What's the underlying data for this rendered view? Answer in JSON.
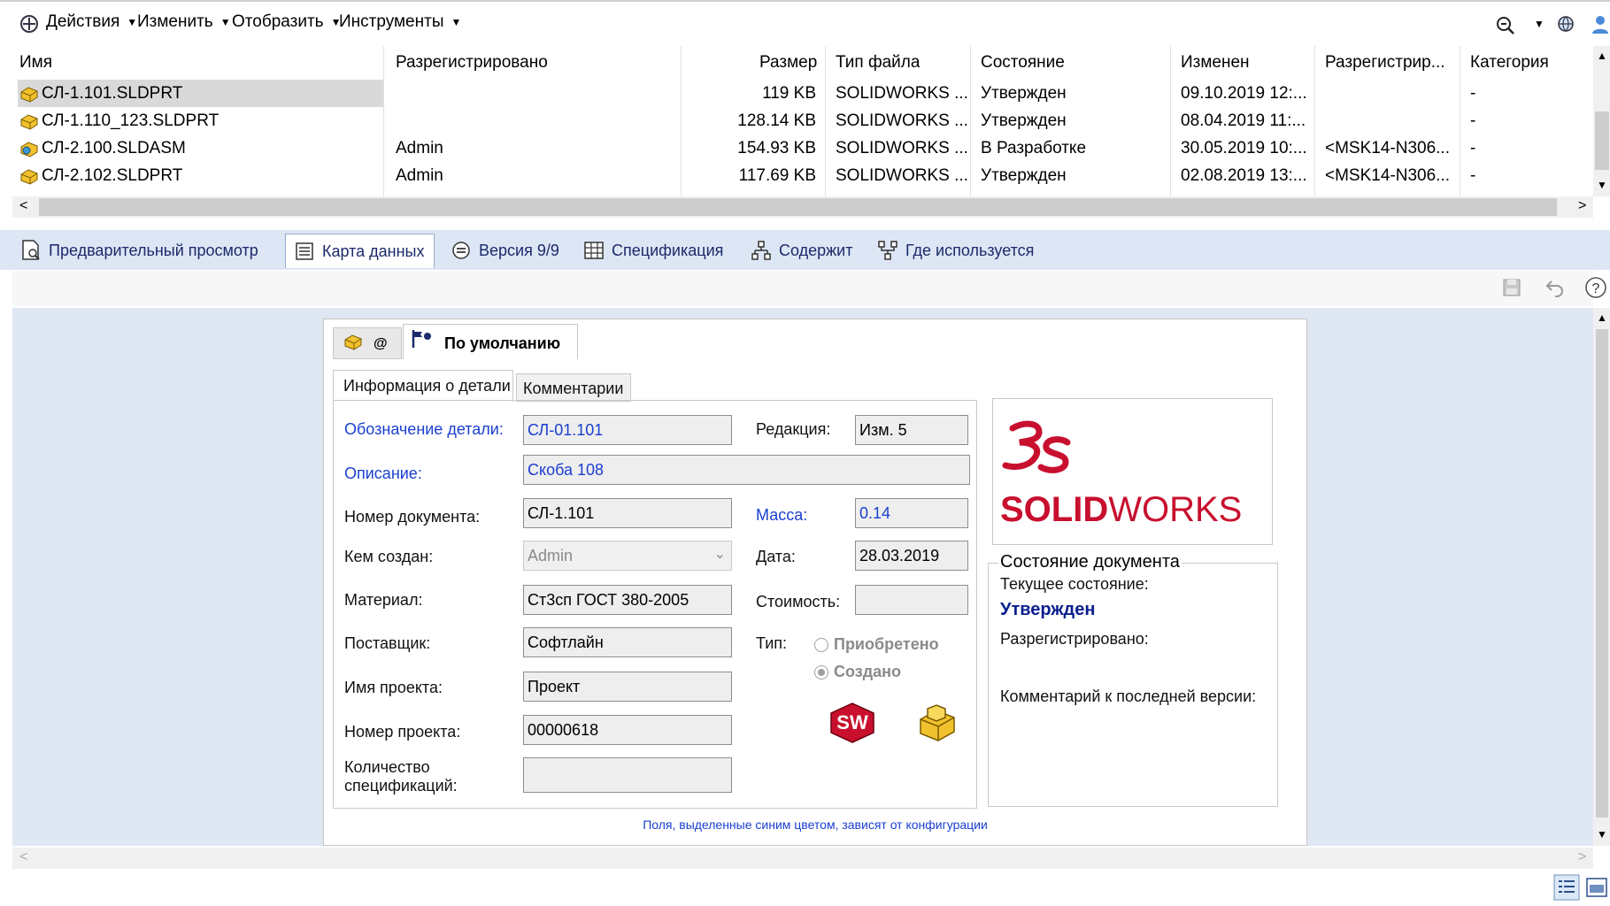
{
  "toolbar": {
    "menus": [
      "Действия",
      "Изменить",
      "Отобразить",
      "Инструменты"
    ]
  },
  "grid": {
    "columns": [
      "Имя",
      "Разрегистрировано",
      "Размер",
      "Тип файла",
      "Состояние",
      "Изменен",
      "Разрегистрир...",
      "Категория"
    ],
    "rows": [
      {
        "name": "СЛ-1.101.SLDPRT",
        "checked_out": "",
        "size": "119 KB",
        "type": "SOLIDWORKS ...",
        "state": "Утвержден",
        "modified": "09.10.2019 12:...",
        "checked_out_in": "",
        "category": "-"
      },
      {
        "name": "СЛ-1.110_123.SLDPRT",
        "checked_out": "",
        "size": "128.14 KB",
        "type": "SOLIDWORKS ...",
        "state": "Утвержден",
        "modified": "08.04.2019 11:...",
        "checked_out_in": "",
        "category": "-"
      },
      {
        "name": "СЛ-2.100.SLDASM",
        "checked_out": "Admin",
        "size": "154.93 KB",
        "type": "SOLIDWORKS ...",
        "state": "В Разработке",
        "modified": "30.05.2019 10:...",
        "checked_out_in": "<MSK14-N306...",
        "category": "-"
      },
      {
        "name": "СЛ-2.102.SLDPRT",
        "checked_out": "Admin",
        "size": "117.69 KB",
        "type": "SOLIDWORKS ...",
        "state": "Утвержден",
        "modified": "02.08.2019 13:...",
        "checked_out_in": "<MSK14-N306...",
        "category": "-"
      }
    ]
  },
  "tabs": [
    {
      "label": "Предварительный просмотр"
    },
    {
      "label": "Карта данных"
    },
    {
      "label": "Версия 9/9"
    },
    {
      "label": "Спецификация"
    },
    {
      "label": "Содержит"
    },
    {
      "label": "Где используется"
    }
  ],
  "card": {
    "config_tabs": {
      "at": "@",
      "default": "По умолчанию"
    },
    "inner_tabs": [
      "Информация о детали",
      "Комментарии"
    ],
    "labels": {
      "designation": "Обозначение детали:",
      "description": "Описание:",
      "doc_number": "Номер документа:",
      "created_by": "Кем создан:",
      "material": "Материал:",
      "supplier": "Поставщик:",
      "project_name": "Имя проекта:",
      "project_number": "Номер проекта:",
      "spec_qty": "Количество спецификаций:",
      "revision": "Редакция:",
      "mass": "Масса:",
      "date": "Дата:",
      "cost": "Стоимость:",
      "type": "Тип:"
    },
    "values": {
      "designation": "СЛ-01.101",
      "description": "Скоба 108",
      "doc_number": "СЛ-1.101",
      "created_by": "Admin",
      "material": "Ст3сп ГОСТ 380-2005",
      "supplier": "Софтлайн",
      "project_name": "Проект",
      "project_number": "00000618",
      "spec_qty": "",
      "revision": "Изм. 5",
      "mass": "0.14",
      "date": "28.03.2019",
      "cost": ""
    },
    "type_options": [
      "Приобретено",
      "Создано"
    ],
    "logo_text_bold": "SOLID",
    "logo_text_light": "WORKS",
    "sw_badge": "SW",
    "state_panel": {
      "title": "Состояние документа",
      "current_label": "Текущее состояние:",
      "current_value": "Утвержден",
      "checked_out_label": "Разрегистрировано:",
      "last_comment_label": "Комментарий к последней версии:"
    },
    "footer_note": "Поля, выделенные синим цветом, зависят от конфигурации"
  },
  "colors": {
    "blue_label": "#1a3fd0",
    "logo_red": "#c8102e",
    "state_blue": "#0a1f8f"
  }
}
